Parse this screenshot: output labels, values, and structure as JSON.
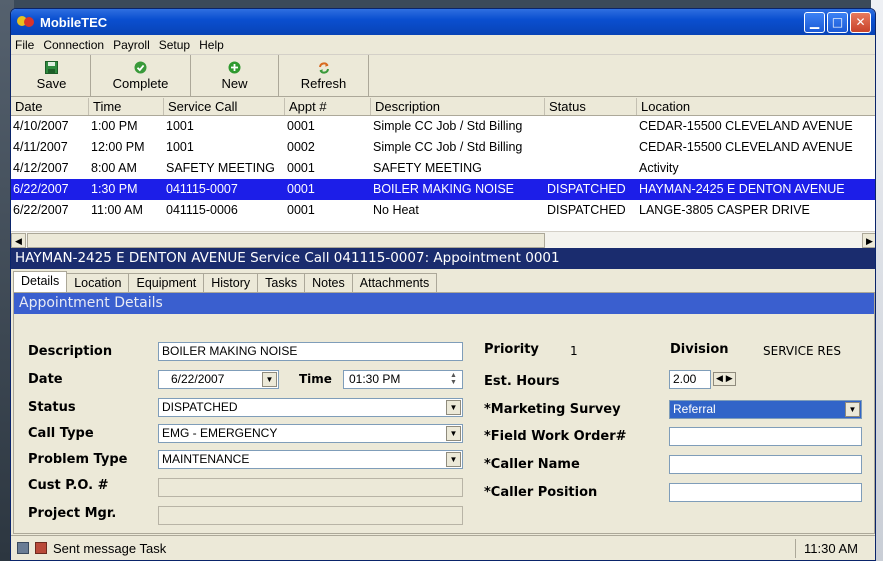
{
  "window": {
    "title": "MobileTEC"
  },
  "menu": [
    "File",
    "Connection",
    "Payroll",
    "Setup",
    "Help"
  ],
  "toolbar": {
    "save": "Save",
    "complete": "Complete",
    "new": "New",
    "refresh": "Refresh"
  },
  "grid": {
    "columns": [
      "Date",
      "Time",
      "Service Call",
      "Appt #",
      "Description",
      "Status",
      "Location"
    ],
    "rows": [
      {
        "date": "4/10/2007",
        "time": "1:00 PM",
        "call": "1001",
        "appt": "0001",
        "desc": "Simple CC Job / Std Billing",
        "status": "",
        "loc": "CEDAR-15500 CLEVELAND AVENUE"
      },
      {
        "date": "4/11/2007",
        "time": "12:00 PM",
        "call": "1001",
        "appt": "0002",
        "desc": "Simple CC Job / Std Billing",
        "status": "",
        "loc": "CEDAR-15500 CLEVELAND AVENUE"
      },
      {
        "date": "4/12/2007",
        "time": "8:00 AM",
        "call": "SAFETY MEETING",
        "appt": "0001",
        "desc": "SAFETY MEETING",
        "status": "",
        "loc": "Activity"
      },
      {
        "date": "6/22/2007",
        "time": "1:30 PM",
        "call": "041115-0007",
        "appt": "0001",
        "desc": "BOILER MAKING NOISE",
        "status": "DISPATCHED",
        "loc": "HAYMAN-2425 E DENTON AVENUE"
      },
      {
        "date": "6/22/2007",
        "time": "11:00 AM",
        "call": "041115-0006",
        "appt": "0001",
        "desc": "No Heat",
        "status": "DISPATCHED",
        "loc": "LANGE-3805 CASPER DRIVE"
      }
    ]
  },
  "selection_header": "HAYMAN-2425 E DENTON AVENUE Service Call 041115-0007: Appointment 0001",
  "tabs": [
    "Details",
    "Location",
    "Equipment",
    "History",
    "Tasks",
    "Notes",
    "Attachments"
  ],
  "details": {
    "section_title": "Appointment Details",
    "description_label": "Description",
    "description_value": "BOILER MAKING NOISE",
    "date_label": "Date",
    "date_value": "6/22/2007",
    "time_label": "Time",
    "time_value": "01:30 PM",
    "status_label": "Status",
    "status_value": "DISPATCHED",
    "call_type_label": "Call Type",
    "call_type_value": "EMG - EMERGENCY",
    "problem_type_label": "Problem Type",
    "problem_type_value": "MAINTENANCE",
    "cust_po_label": "Cust P.O. #",
    "cust_po_value": "",
    "project_mgr_label": "Project Mgr.",
    "project_mgr_value": "",
    "priority_label": "Priority",
    "priority_value": "1",
    "division_label": "Division",
    "division_value": "SERVICE RES",
    "est_hours_label": "Est. Hours",
    "est_hours_value": "2.00",
    "marketing_label": "*Marketing Survey",
    "marketing_value": "Referral",
    "field_work_label": "*Field Work Order#",
    "field_work_value": "",
    "caller_name_label": "*Caller Name",
    "caller_name_value": "",
    "caller_position_label": "*Caller Position",
    "caller_position_value": ""
  },
  "status": {
    "message": "Sent message Task",
    "clock": "11:30 AM"
  },
  "colors": {
    "title_bar": "#0a4fd0",
    "selected_row": "#1c1ee8",
    "header_band": "#1a2c6e",
    "section_title": "#3a5fcf"
  }
}
